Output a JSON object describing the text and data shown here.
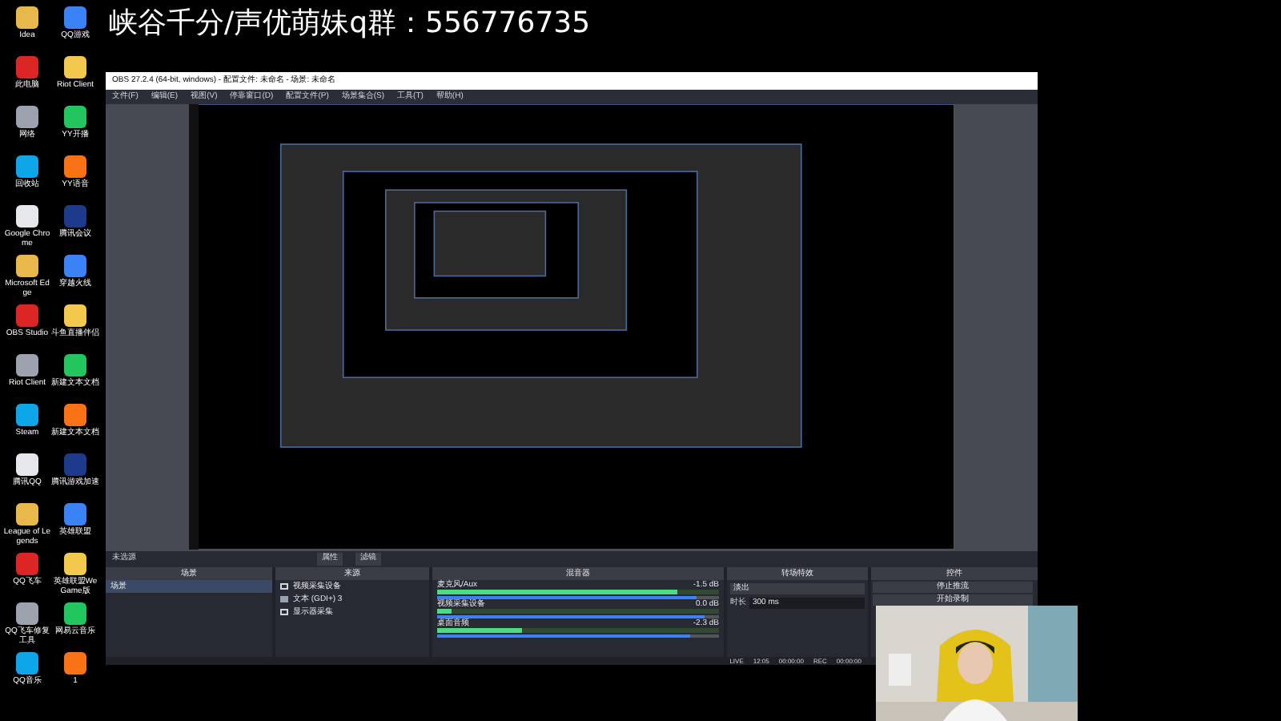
{
  "banner": {
    "text": "峡谷千分/声优萌妹q群：556776735"
  },
  "desktop_icons": [
    {
      "label": "Idea"
    },
    {
      "label": "QQ游戏"
    },
    {
      "label": "此电脑"
    },
    {
      "label": "Riot Client"
    },
    {
      "label": "网络"
    },
    {
      "label": "YY开播"
    },
    {
      "label": "回收站"
    },
    {
      "label": "YY语音"
    },
    {
      "label": "Google Chrome"
    },
    {
      "label": "腾讯会议"
    },
    {
      "label": "Microsoft Edge"
    },
    {
      "label": "穿越火线"
    },
    {
      "label": "OBS Studio"
    },
    {
      "label": "斗鱼直播伴侣"
    },
    {
      "label": "Riot Client"
    },
    {
      "label": "新建文本文档"
    },
    {
      "label": "Steam"
    },
    {
      "label": "新建文本文档"
    },
    {
      "label": "腾讯QQ"
    },
    {
      "label": "腾讯游戏加速"
    },
    {
      "label": "League of Legends"
    },
    {
      "label": "英雄联盟"
    },
    {
      "label": "QQ飞车"
    },
    {
      "label": "英雄联盟WeGame版"
    },
    {
      "label": "QQ飞车修复工具"
    },
    {
      "label": "网易云音乐"
    },
    {
      "label": "QQ音乐"
    },
    {
      "label": "1"
    }
  ],
  "obs": {
    "title": "OBS 27.2.4 (64-bit, windows) - 配置文件: 未命名 - 场景: 未命名",
    "menu": [
      "文件(F)",
      "编辑(E)",
      "视图(V)",
      "停靠窗口(D)",
      "配置文件(P)",
      "场景集合(S)",
      "工具(T)",
      "帮助(H)"
    ],
    "no_source": "未选源",
    "source_buttons": [
      "属性",
      "滤镜"
    ],
    "docks": {
      "scenes": {
        "title": "场景",
        "items": [
          {
            "label": "场景",
            "selected": true
          }
        ]
      },
      "sources": {
        "title": "来源",
        "items": [
          {
            "label": "视频采集设备",
            "kind": "camera"
          },
          {
            "label": "文本 (GDI+) 3",
            "kind": "text"
          },
          {
            "label": "显示器采集",
            "kind": "monitor"
          }
        ]
      },
      "mixer": {
        "title": "混音器",
        "channels": [
          {
            "name": "麦克风/Aux",
            "reading": "-1.5 dB",
            "meter": {
              "level": 0.85
            },
            "fader": {
              "level": 0.92
            }
          },
          {
            "name": "视频采集设备",
            "reading": "0.0 dB",
            "meter": {
              "level": 0.05
            },
            "fader": {
              "level": 0.95
            }
          },
          {
            "name": "桌面音频",
            "reading": "-2.3 dB",
            "meter": {
              "level": 0.3
            },
            "fader": {
              "level": 0.9
            }
          }
        ]
      },
      "transitions": {
        "title": "转场特效",
        "type": "淡出",
        "duration_label": "时长",
        "duration": "300 ms"
      },
      "controls": {
        "title": "控件",
        "buttons": [
          "停止推流",
          "开始录制"
        ]
      }
    },
    "status": [
      "LIVE",
      "12:05",
      "00:00:00",
      "REC",
      "00:00:00"
    ]
  }
}
